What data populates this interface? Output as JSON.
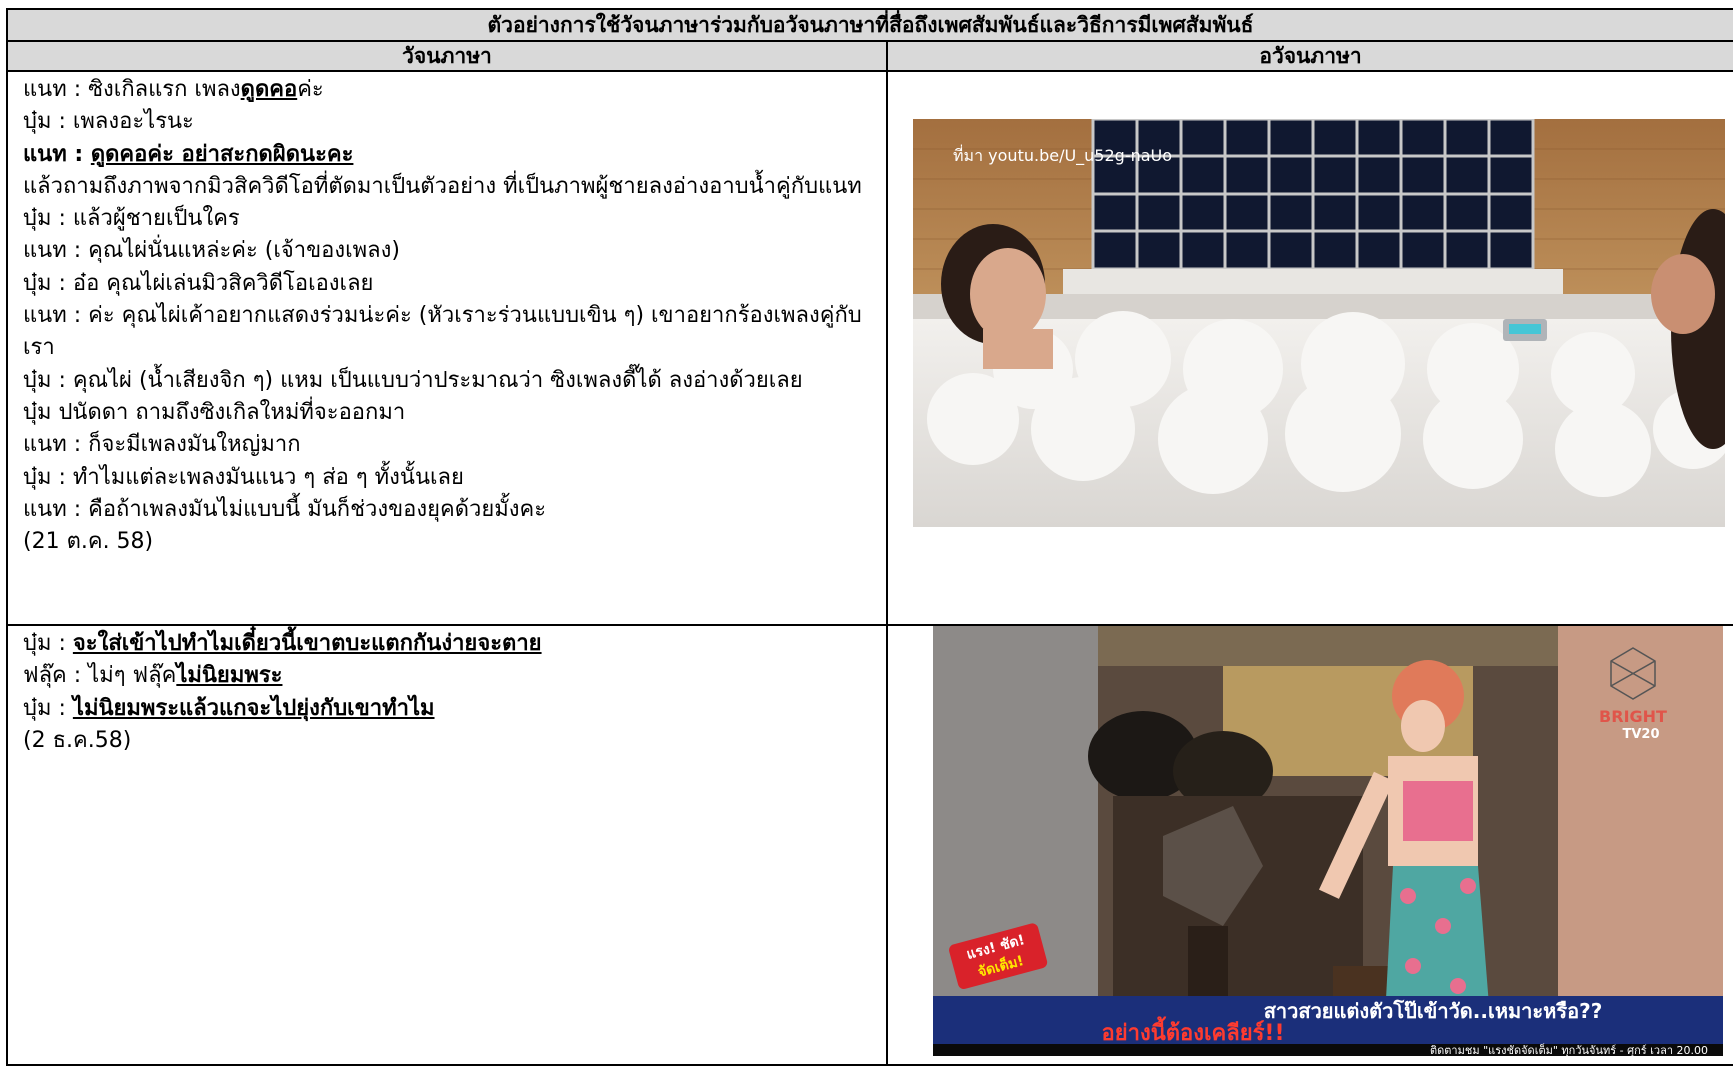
{
  "table": {
    "title": "ตัวอย่างการใช้วัจนภาษาร่วมกับอวัจนภาษาที่สื่อถึงเพศสัมพันธ์และวิธีการมีเพศสัมพันธ์",
    "col_left": "วัจนภาษา",
    "col_right": "อวัจนภาษา"
  },
  "row1": {
    "l1a": "แนท : ซิงเกิลแรก เพลง",
    "l1b": "ดูดคอ",
    "l1c": "ค่ะ",
    "l2": "บุ๋ม : เพลงอะไรนะ",
    "l3a": "แนท : ",
    "l3b": "ดูดคอค่ะ อย่าสะกดผิดนะคะ",
    "l4": "แล้วถามถึงภาพจากมิวสิควิดีโอที่ตัดมาเป็นตัวอย่าง ที่เป็นภาพผู้ชายลงอ่างอาบน้ำคู่กับแนท",
    "l5": "บุ๋ม : แล้วผู้ชายเป็นใคร",
    "l6": "แนท : คุณไผ่นั่นแหล่ะค่ะ (เจ้าของเพลง)",
    "l7": "บุ๋ม : อ๋อ คุณไผ่เล่นมิวสิควิดีโอเองเลย",
    "l8": "แนท : ค่ะ คุณไผ่เค้าอยากแสดงร่วมน่ะค่ะ (หัวเราะร่วนแบบเขิน ๆ) เขาอยากร้องเพลงคู่กับเรา",
    "l9": "บุ๋ม : คุณไผ่ (น้ำเสียงจิก ๆ) แหม เป็นแบบว่าประมาณว่า ซิงเพลงดี๊ได้ ลงอ่างด้วยเลย",
    "l10": "บุ๋ม ปนัดดา ถามถึงซิงเกิลใหม่ที่จะออกมา",
    "l11": "แนท : ก็จะมีเพลงมันใหญ่มาก",
    "l12": "บุ๋ม : ทำไมแต่ละเพลงมันแนว ๆ ส่อ ๆ ทั้งนั้นเลย",
    "l13": "แนท : คือถ้าเพลงมันไม่แบบนี้ มันก็ช่วงของยุคด้วยมั้งคะ",
    "l14": "(21 ต.ค. 58)",
    "img_caption": "ที่มา youtu.be/U_u52g-naUo"
  },
  "row2": {
    "l1a": "บุ๋ม : ",
    "l1b": "จะใส่เข้าไปทำไมเดี๋ยวนี้เขาตบะแตกกันง่ายจะตาย",
    "l2a": "ฟลุ๊ค : ไม่ๆ ฟลุ๊ค",
    "l2b": "ไม่นิยมพระ",
    "l3a": "บุ๋ม : ",
    "l3b": "ไม่นิยมพระแล้วแกจะไปยุ่งกับเขาทำไม",
    "l4": "(2 ธ.ค.58)",
    "logo_top": "BRIGHT",
    "logo_bottom": "TV20",
    "badge_top": "แรง! ชัด!",
    "badge_bottom": "จัดเต็ม!",
    "caption1": "สาวสวยแต่งตัวโป๊เข้าวัด..เหมาะหรือ??",
    "caption2": "อย่างนี้ต้องเคลียร์!!",
    "ticker": "ติดตามชม \"แรงชัดจัดเต็ม\" ทุกวันจันทร์ - ศุกร์ เวลา 20.00"
  }
}
